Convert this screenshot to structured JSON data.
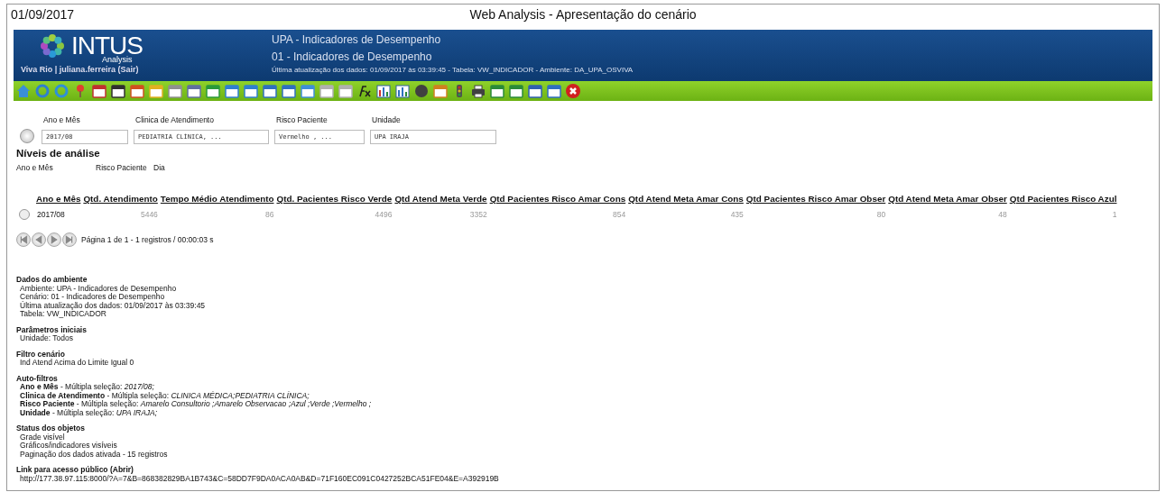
{
  "window": {
    "date": "01/09/2017",
    "title": "Web Analysis - Apresentação do cenário"
  },
  "header": {
    "logo_text": "INTUS",
    "logo_sub": "Analysis",
    "user_line": "Viva Rio | juliana.ferreira (Sair)",
    "environment": "UPA - Indicadores de Desempenho",
    "scenario": "01 - Indicadores de Desempenho",
    "update_info": "Última atualização dos dados: 01/09/2017 às 03:39:45 - Tabela: VW_INDICADOR - Ambiente: DA_UPA_OSVIVA"
  },
  "filters": [
    {
      "label": "Ano e Mês",
      "value": "2017/08"
    },
    {
      "label": "Clinica de Atendimento",
      "value": "PEDIATRIA CLÍNICA, ..."
    },
    {
      "label": "Risco Paciente",
      "value": "Vermelho , ..."
    },
    {
      "label": "Unidade",
      "value": "UPA IRAJA"
    }
  ],
  "levels": {
    "title": "Níveis de análise",
    "items": [
      "Ano e Mês",
      "Risco Paciente",
      "Dia"
    ]
  },
  "table": {
    "columns": [
      "Ano e Mês",
      "Qtd. Atendimento",
      "Tempo Médio Atendimento",
      "Qtd. Pacientes Risco Verde",
      "Qtd Atend Meta Verde",
      "Qtd Pacientes Risco Amar Cons",
      "Qtd Atend Meta Amar Cons",
      "Qtd Pacientes Risco Amar Obser",
      "Qtd Atend Meta Amar Obser",
      "Qtd Pacientes Risco Azul"
    ],
    "rows": [
      {
        "selected": false,
        "cells": [
          "2017/08",
          "5446",
          "86",
          "4496",
          "3352",
          "854",
          "435",
          "80",
          "48",
          "1"
        ]
      }
    ]
  },
  "pagination": "Página 1 de 1 - 1 registros / 00:00:03 s",
  "sections": [
    {
      "title": "Dados do ambiente",
      "lines": [
        "Ambiente: UPA - Indicadores de Desempenho",
        "Cenário: 01 - Indicadores de Desempenho",
        "Última atualização dos dados: 01/09/2017 às 03:39:45",
        "Tabela: VW_INDICADOR"
      ]
    },
    {
      "title": "Parâmetros iniciais",
      "lines": [
        "Unidade: Todos"
      ]
    },
    {
      "title": "Filtro cenário",
      "lines": [
        "Ind Atend Acima do Limite Igual 0"
      ]
    },
    {
      "title": "Auto-filtros",
      "lines": [
        "**Ano e Mês** - Múltipla seleção: *2017/08;*",
        "**Clinica de Atendimento** - Múltipla seleção: *CLINICA MÉDICA;PEDIATRIA CLÍNICA;*",
        "**Risco Paciente** - Múltipla seleção: *Amarelo Consultorio ;Amarelo Observacao ;Azul ;Verde ;Vermelho ;*",
        "**Unidade** - Múltipla seleção: *UPA IRAJA;*"
      ]
    },
    {
      "title": "Status dos objetos",
      "lines": [
        "Grade visível",
        "Gráficos/indicadores visíveis",
        "Paginação dos dados ativada - 15 registros"
      ]
    },
    {
      "title": "Link para acesso público (Abrir)",
      "lines": [
        "http://177.38.97.115:8000/?A=7&B=868382829BA1B743&C=58DD7F9DA0ACA0AB&D=71F160EC091C0427252BCA51FE04&E=A392919B"
      ]
    }
  ]
}
